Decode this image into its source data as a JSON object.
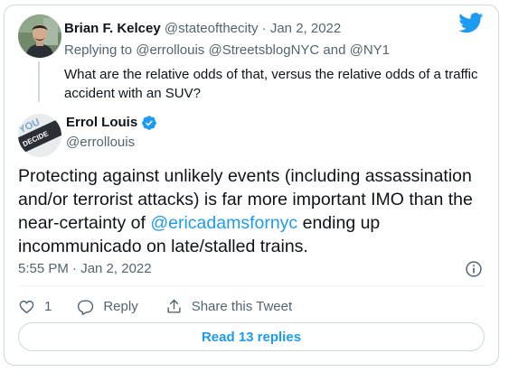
{
  "colors": {
    "link": "#1d9bf0",
    "text": "#0f1419",
    "secondary": "#536471",
    "border": "#cfd9de"
  },
  "parent_tweet": {
    "name": "Brian F. Kelcey",
    "handle": "@stateofthecity",
    "separator": "·",
    "date": "Jan 2, 2022",
    "replying_to": "Replying to @errollouis @StreetsblogNYC and @NY1",
    "text": "What are the relative odds of that, versus the relative odds of a traffic accident with an SUV?"
  },
  "main_tweet": {
    "name": "Errol Louis",
    "verified": true,
    "handle": "@errollouis",
    "text_before": "Protecting against unlikely events (including assassination and/or terrorist attacks) is far more important IMO than the near-certainty of ",
    "mention": "@ericadamsfornyc",
    "text_after": " ending up incommunicado on late/stalled trains.",
    "timestamp": "5:55 PM · Jan 2, 2022",
    "avatar_text": "YOU DECIDE"
  },
  "actions": {
    "like_count": "1",
    "reply_label": "Reply",
    "share_label": "Share this Tweet"
  },
  "read_replies_label": "Read 13 replies",
  "icons": [
    "twitter-bird-icon",
    "verified-badge-icon",
    "info-icon",
    "heart-icon",
    "reply-icon",
    "share-icon"
  ]
}
